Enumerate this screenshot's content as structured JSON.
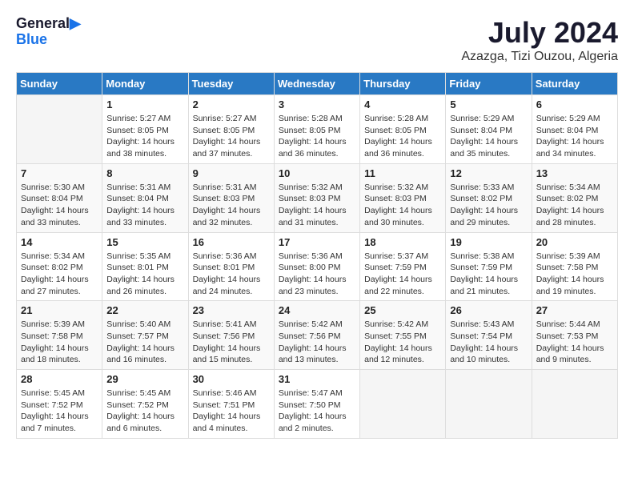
{
  "header": {
    "logo_line1": "General",
    "logo_line2": "Blue",
    "title": "July 2024",
    "subtitle": "Azazga, Tizi Ouzou, Algeria"
  },
  "days_of_week": [
    "Sunday",
    "Monday",
    "Tuesday",
    "Wednesday",
    "Thursday",
    "Friday",
    "Saturday"
  ],
  "weeks": [
    [
      {
        "day": "",
        "info": ""
      },
      {
        "day": "1",
        "info": "Sunrise: 5:27 AM\nSunset: 8:05 PM\nDaylight: 14 hours\nand 38 minutes."
      },
      {
        "day": "2",
        "info": "Sunrise: 5:27 AM\nSunset: 8:05 PM\nDaylight: 14 hours\nand 37 minutes."
      },
      {
        "day": "3",
        "info": "Sunrise: 5:28 AM\nSunset: 8:05 PM\nDaylight: 14 hours\nand 36 minutes."
      },
      {
        "day": "4",
        "info": "Sunrise: 5:28 AM\nSunset: 8:05 PM\nDaylight: 14 hours\nand 36 minutes."
      },
      {
        "day": "5",
        "info": "Sunrise: 5:29 AM\nSunset: 8:04 PM\nDaylight: 14 hours\nand 35 minutes."
      },
      {
        "day": "6",
        "info": "Sunrise: 5:29 AM\nSunset: 8:04 PM\nDaylight: 14 hours\nand 34 minutes."
      }
    ],
    [
      {
        "day": "7",
        "info": "Sunrise: 5:30 AM\nSunset: 8:04 PM\nDaylight: 14 hours\nand 33 minutes."
      },
      {
        "day": "8",
        "info": "Sunrise: 5:31 AM\nSunset: 8:04 PM\nDaylight: 14 hours\nand 33 minutes."
      },
      {
        "day": "9",
        "info": "Sunrise: 5:31 AM\nSunset: 8:03 PM\nDaylight: 14 hours\nand 32 minutes."
      },
      {
        "day": "10",
        "info": "Sunrise: 5:32 AM\nSunset: 8:03 PM\nDaylight: 14 hours\nand 31 minutes."
      },
      {
        "day": "11",
        "info": "Sunrise: 5:32 AM\nSunset: 8:03 PM\nDaylight: 14 hours\nand 30 minutes."
      },
      {
        "day": "12",
        "info": "Sunrise: 5:33 AM\nSunset: 8:02 PM\nDaylight: 14 hours\nand 29 minutes."
      },
      {
        "day": "13",
        "info": "Sunrise: 5:34 AM\nSunset: 8:02 PM\nDaylight: 14 hours\nand 28 minutes."
      }
    ],
    [
      {
        "day": "14",
        "info": "Sunrise: 5:34 AM\nSunset: 8:02 PM\nDaylight: 14 hours\nand 27 minutes."
      },
      {
        "day": "15",
        "info": "Sunrise: 5:35 AM\nSunset: 8:01 PM\nDaylight: 14 hours\nand 26 minutes."
      },
      {
        "day": "16",
        "info": "Sunrise: 5:36 AM\nSunset: 8:01 PM\nDaylight: 14 hours\nand 24 minutes."
      },
      {
        "day": "17",
        "info": "Sunrise: 5:36 AM\nSunset: 8:00 PM\nDaylight: 14 hours\nand 23 minutes."
      },
      {
        "day": "18",
        "info": "Sunrise: 5:37 AM\nSunset: 7:59 PM\nDaylight: 14 hours\nand 22 minutes."
      },
      {
        "day": "19",
        "info": "Sunrise: 5:38 AM\nSunset: 7:59 PM\nDaylight: 14 hours\nand 21 minutes."
      },
      {
        "day": "20",
        "info": "Sunrise: 5:39 AM\nSunset: 7:58 PM\nDaylight: 14 hours\nand 19 minutes."
      }
    ],
    [
      {
        "day": "21",
        "info": "Sunrise: 5:39 AM\nSunset: 7:58 PM\nDaylight: 14 hours\nand 18 minutes."
      },
      {
        "day": "22",
        "info": "Sunrise: 5:40 AM\nSunset: 7:57 PM\nDaylight: 14 hours\nand 16 minutes."
      },
      {
        "day": "23",
        "info": "Sunrise: 5:41 AM\nSunset: 7:56 PM\nDaylight: 14 hours\nand 15 minutes."
      },
      {
        "day": "24",
        "info": "Sunrise: 5:42 AM\nSunset: 7:56 PM\nDaylight: 14 hours\nand 13 minutes."
      },
      {
        "day": "25",
        "info": "Sunrise: 5:42 AM\nSunset: 7:55 PM\nDaylight: 14 hours\nand 12 minutes."
      },
      {
        "day": "26",
        "info": "Sunrise: 5:43 AM\nSunset: 7:54 PM\nDaylight: 14 hours\nand 10 minutes."
      },
      {
        "day": "27",
        "info": "Sunrise: 5:44 AM\nSunset: 7:53 PM\nDaylight: 14 hours\nand 9 minutes."
      }
    ],
    [
      {
        "day": "28",
        "info": "Sunrise: 5:45 AM\nSunset: 7:52 PM\nDaylight: 14 hours\nand 7 minutes."
      },
      {
        "day": "29",
        "info": "Sunrise: 5:45 AM\nSunset: 7:52 PM\nDaylight: 14 hours\nand 6 minutes."
      },
      {
        "day": "30",
        "info": "Sunrise: 5:46 AM\nSunset: 7:51 PM\nDaylight: 14 hours\nand 4 minutes."
      },
      {
        "day": "31",
        "info": "Sunrise: 5:47 AM\nSunset: 7:50 PM\nDaylight: 14 hours\nand 2 minutes."
      },
      {
        "day": "",
        "info": ""
      },
      {
        "day": "",
        "info": ""
      },
      {
        "day": "",
        "info": ""
      }
    ]
  ]
}
